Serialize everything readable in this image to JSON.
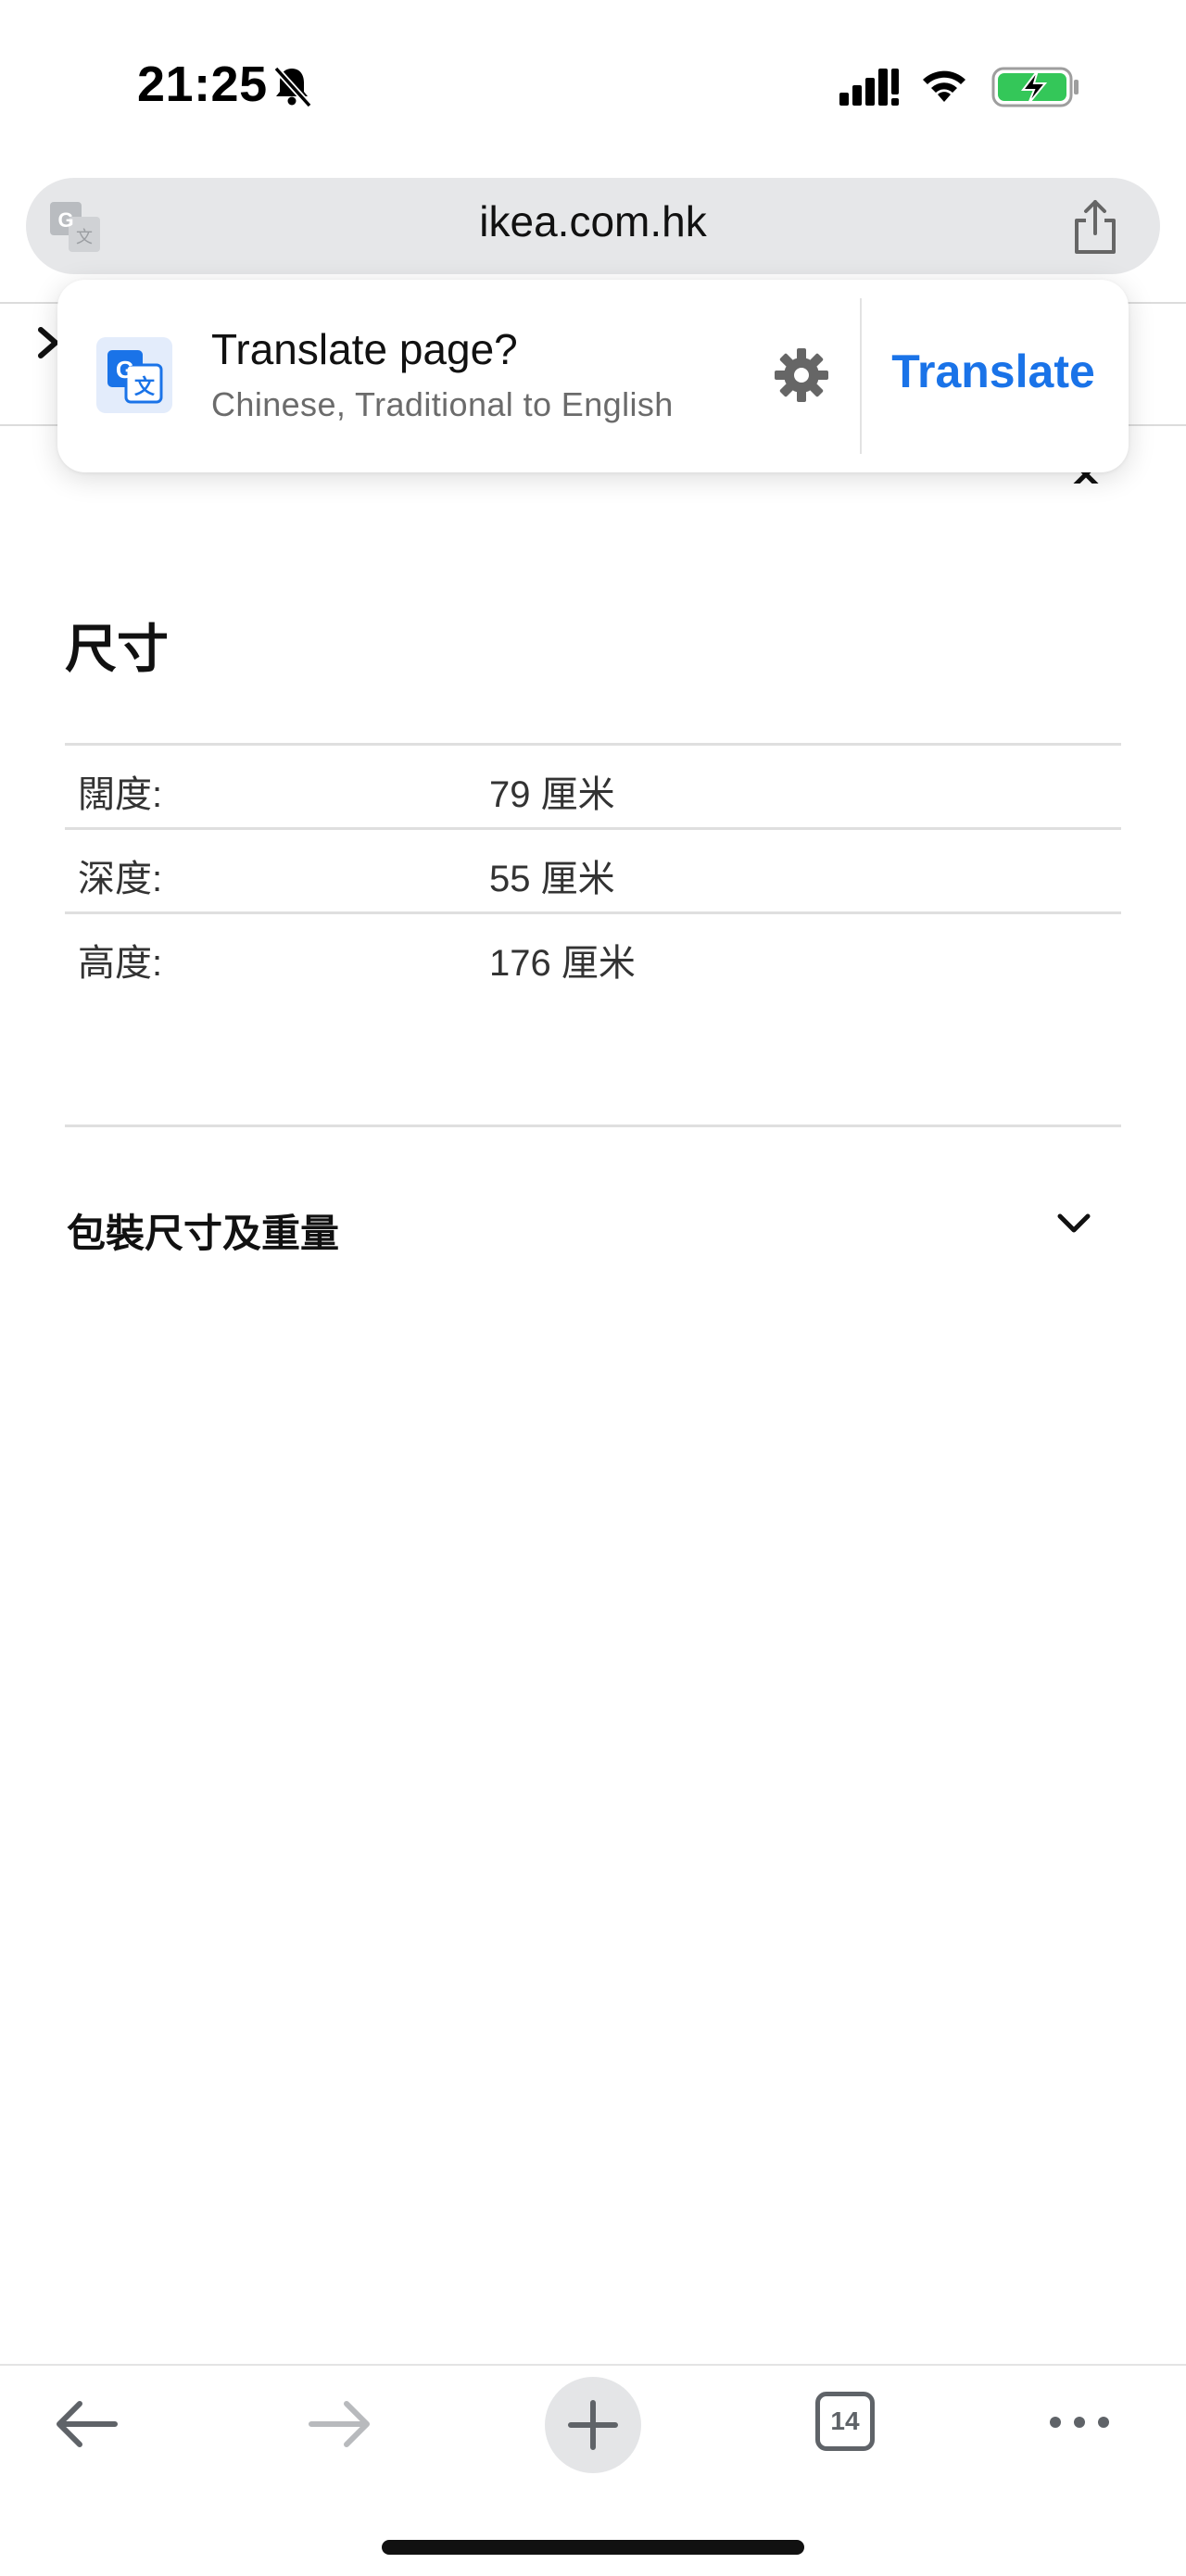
{
  "status_bar": {
    "time": "21:25",
    "icons": [
      "bell-muted-icon",
      "cellular-signal-icon",
      "wifi-icon",
      "battery-charging-icon"
    ]
  },
  "address_bar": {
    "url": "ikea.com.hk",
    "left_icon": "google-translate-icon",
    "right_icon": "share-icon"
  },
  "translate_popup": {
    "title": "Translate page?",
    "subtitle": "Chinese, Traditional to English",
    "settings_icon": "gear-icon",
    "action_label": "Translate",
    "action_color": "#1a73e8"
  },
  "dimensions": {
    "heading": "尺寸",
    "rows": [
      {
        "label": "闊度:",
        "value": "79 厘米"
      },
      {
        "label": "深度:",
        "value": "55 厘米"
      },
      {
        "label": "高度:",
        "value": "176 厘米"
      }
    ]
  },
  "package": {
    "heading": "包裝尺寸及重量",
    "expand_icon": "chevron-down-icon"
  },
  "toolbar": {
    "tab_count": "14",
    "icons": [
      "back-arrow-icon",
      "forward-arrow-icon",
      "plus-icon",
      "tabs-icon",
      "more-icon"
    ]
  }
}
